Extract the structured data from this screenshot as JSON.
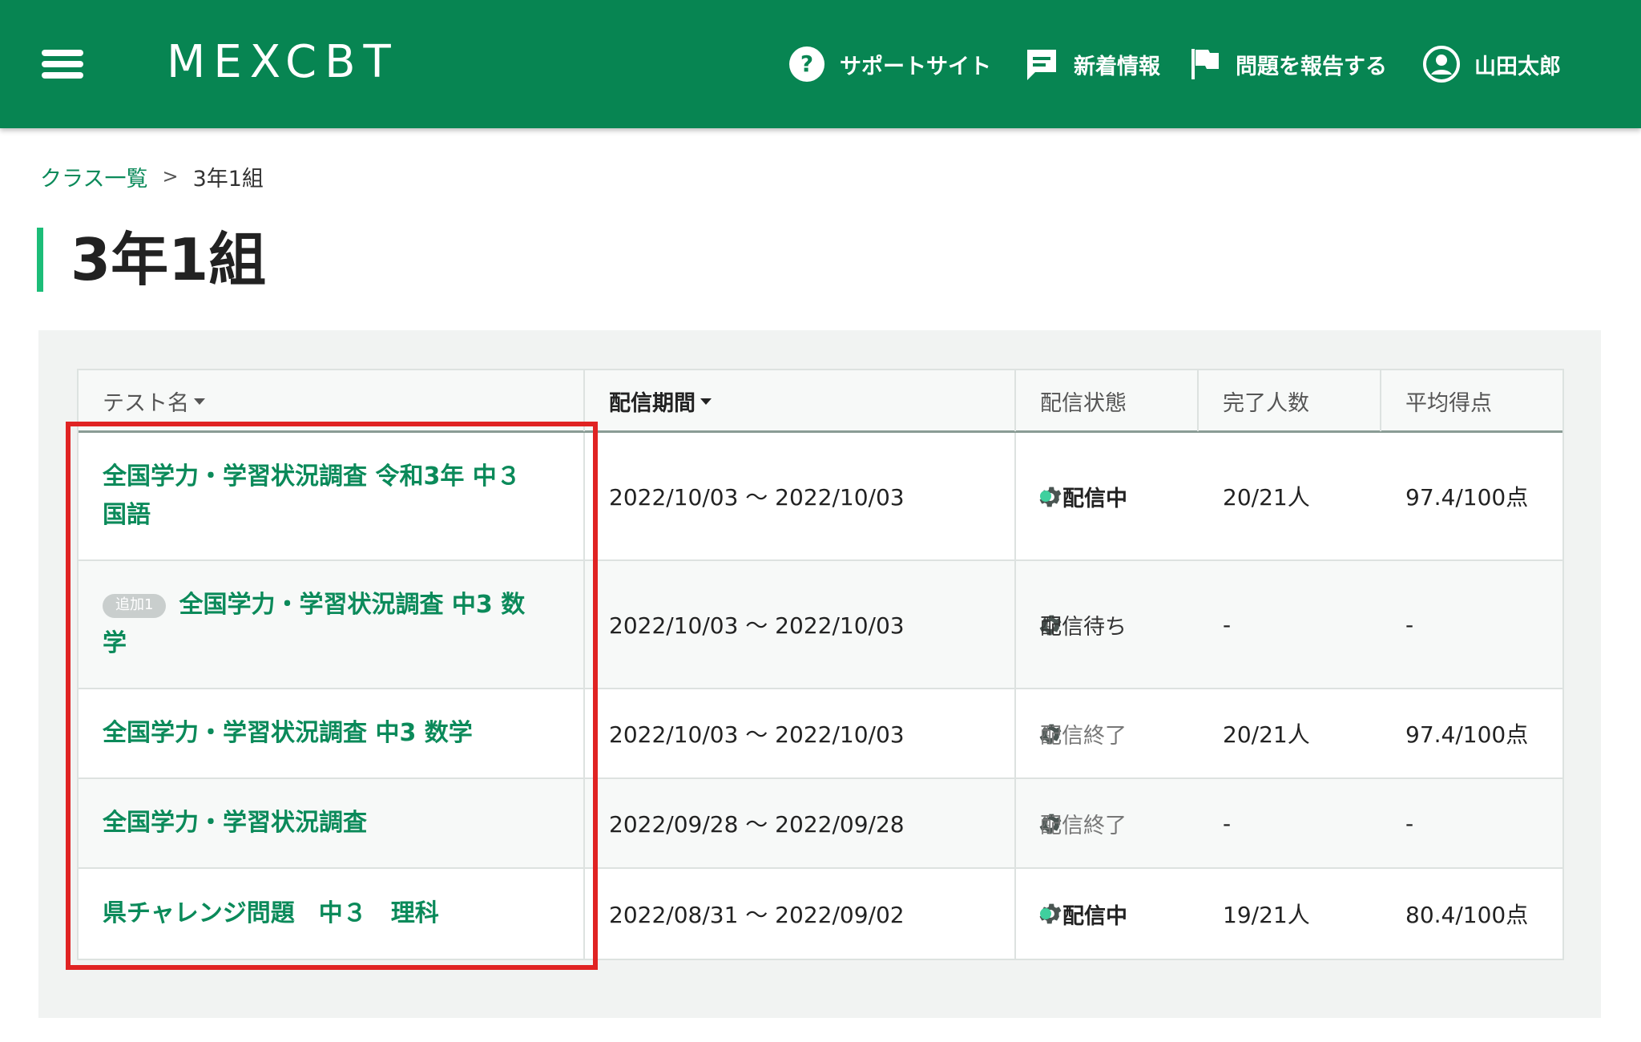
{
  "header": {
    "logo": "MEXCBT",
    "nav": {
      "support": "サポートサイト",
      "news": "新着情報",
      "report": "問題を報告する",
      "user": "山田太郎"
    },
    "icons": [
      "menu-icon",
      "help-circle-icon",
      "message-icon",
      "flag-icon",
      "account-circle-icon"
    ],
    "background_color": "#078552"
  },
  "breadcrumb": {
    "parent": "クラス一覧",
    "separator": ">",
    "current": "3年1組"
  },
  "page": {
    "title": "3年1組",
    "accent_color": "#1cbd78"
  },
  "table": {
    "columns": {
      "name": "テスト名",
      "period": "配信期間",
      "status": "配信状態",
      "done": "完了人数",
      "avg": "平均得点"
    },
    "rows": [
      {
        "badge": "",
        "name": "全国学力・学習状況調査 令和3年 中３ 国語",
        "period": "2022/10/03 〜 2022/10/03",
        "status": "配信中",
        "done": "20/21人",
        "avg": "97.4/100点"
      },
      {
        "badge": "追加1",
        "name": "全国学力・学習状況調査 中3 数学",
        "period": "2022/10/03 〜 2022/10/03",
        "status": "配信待ち",
        "done": "-",
        "avg": "-"
      },
      {
        "badge": "",
        "name": "全国学力・学習状況調査 中3 数学",
        "period": "2022/10/03 〜 2022/10/03",
        "status": "配信終了",
        "done": "20/21人",
        "avg": "97.4/100点"
      },
      {
        "badge": "",
        "name": "全国学力・学習状況調査",
        "period": "2022/09/28 〜 2022/09/28",
        "status": "配信終了",
        "done": "-",
        "avg": "-"
      },
      {
        "badge": "",
        "name": "県チャレンジ問題　中３　理科",
        "period": "2022/08/31 〜 2022/09/02",
        "status": "配信中",
        "done": "19/21人",
        "avg": "80.4/100点"
      }
    ]
  },
  "highlight_color": "#e02323",
  "status_live_dot_color": "#3fd09e"
}
